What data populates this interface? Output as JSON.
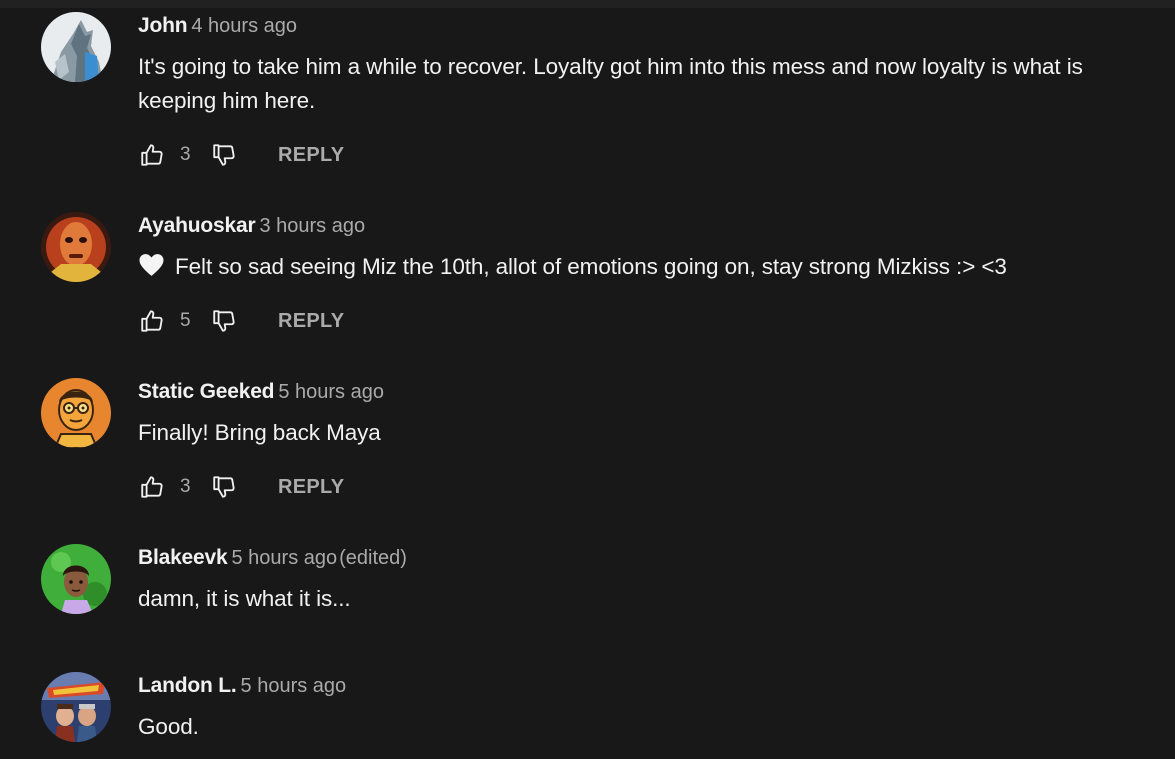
{
  "comments": [
    {
      "author": "John",
      "time": "4 hours ago",
      "text": "It's going to take him a while to recover. Loyalty got him into this mess and now loyalty is what is keeping him here.",
      "likes": "3",
      "reply_label": "REPLY",
      "avatar_icon": "wolf-avatar"
    },
    {
      "author": "Ayahuoskar",
      "time": "3 hours ago",
      "text": "Felt so sad seeing Miz the 10th, allot of emotions going on, stay strong Mizkiss :> <3",
      "text_emoji": "white-heart-icon",
      "likes": "5",
      "reply_label": "REPLY",
      "avatar_icon": "red-face-avatar"
    },
    {
      "author": "Static Geeked",
      "time": "5 hours ago",
      "text": "Finally! Bring back Maya",
      "likes": "3",
      "reply_label": "REPLY",
      "avatar_icon": "cartoon-glasses-avatar"
    },
    {
      "author": "Blakeevk",
      "time": "5 hours ago",
      "edited": "(edited)",
      "text": "damn, it is what it is...",
      "avatar_icon": "cartoon-person-avatar"
    },
    {
      "author": "Landon L.",
      "time": "5 hours ago",
      "text": "Good.",
      "avatar_icon": "movie-poster-avatar"
    }
  ],
  "colors": {
    "background": "#181818",
    "primary_text": "#f1f1f1",
    "secondary_text": "#aaaaaa"
  }
}
